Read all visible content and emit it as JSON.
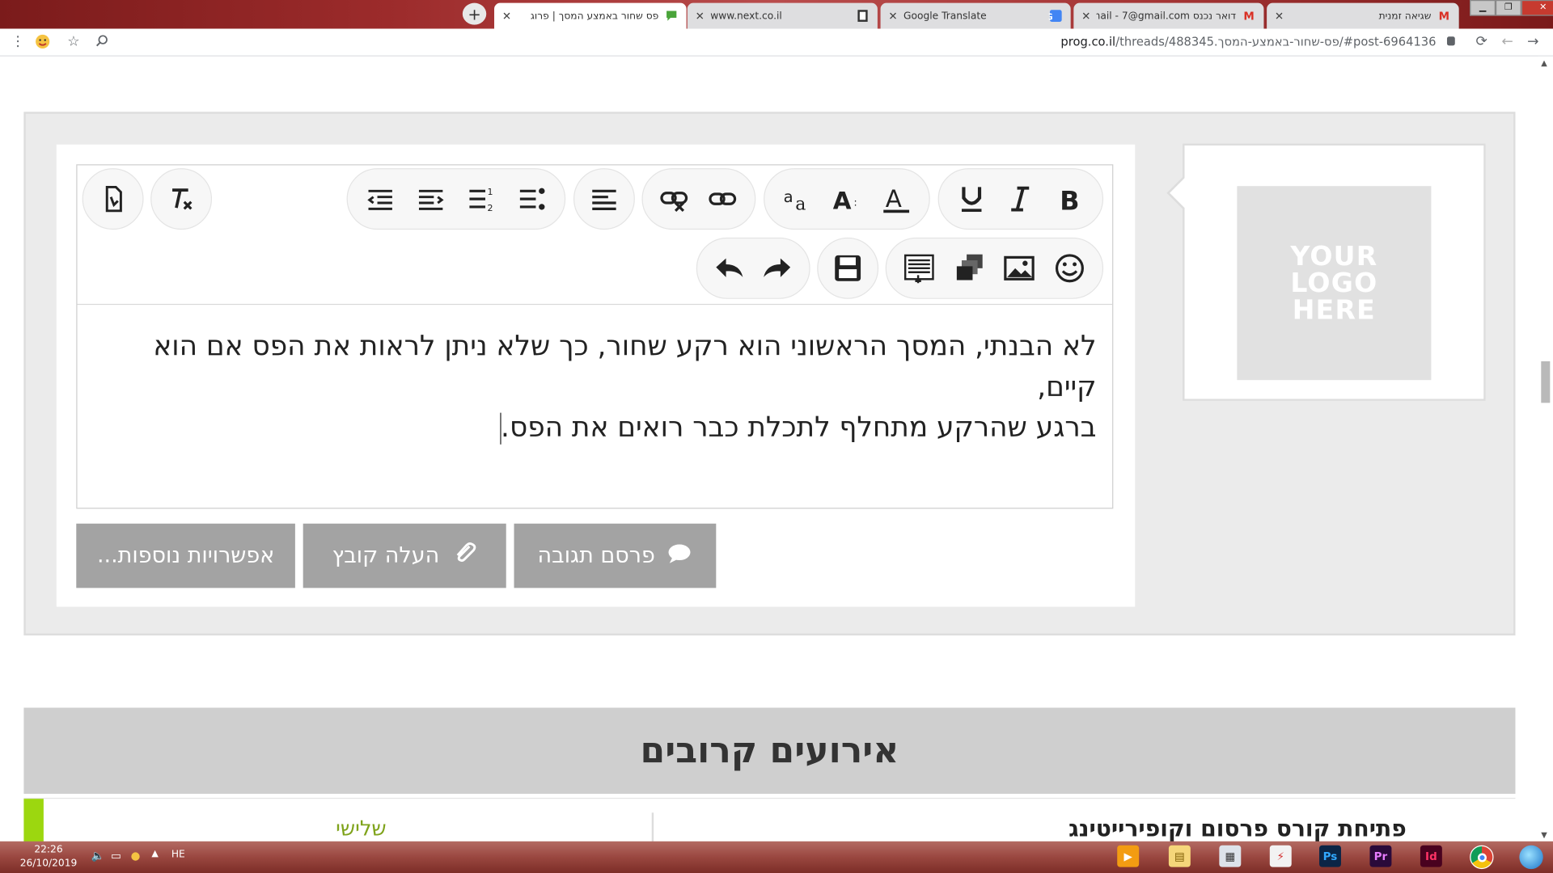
{
  "browser": {
    "tabs": [
      {
        "title": "פס שחור באמצע המסך | פרוג",
        "active": true,
        "favicon": "chat-bubble-icon"
      },
      {
        "title": "www.next.co.il",
        "active": false,
        "favicon": "page-icon"
      },
      {
        "title": "Google Translate",
        "active": false,
        "favicon": "translate-icon"
      },
      {
        "title": "דואר נכנס Gmail - 7@gmail.com",
        "active": false,
        "favicon": "gmail-icon"
      },
      {
        "title": "שגיאה זמנית",
        "active": false,
        "favicon": "gmail-icon"
      }
    ],
    "new_tab": "+",
    "url_domain": "prog.co.il",
    "url_path": "/threads/488345.פס-שחור-באמצע-המסך/#post-6964136"
  },
  "editor": {
    "toolbar": [
      {
        "name": "bold-icon",
        "label": "B"
      },
      {
        "name": "italic-icon",
        "label": "I"
      },
      {
        "name": "underline-icon",
        "label": "U"
      },
      {
        "name": "font-color-icon",
        "label": "A"
      },
      {
        "name": "font-size-icon",
        "label": "A:"
      },
      {
        "name": "font-family-icon",
        "label": "aa"
      },
      {
        "name": "link-icon"
      },
      {
        "name": "unlink-icon"
      },
      {
        "name": "align-icon"
      },
      {
        "name": "bullet-list-icon"
      },
      {
        "name": "numbered-list-icon"
      },
      {
        "name": "indent-icon"
      },
      {
        "name": "outdent-icon"
      },
      {
        "name": "remove-format-icon"
      },
      {
        "name": "bbcode-icon"
      },
      {
        "name": "smiley-icon"
      },
      {
        "name": "image-icon"
      },
      {
        "name": "media-icon"
      },
      {
        "name": "insert-icon"
      },
      {
        "name": "save-draft-icon"
      },
      {
        "name": "redo-icon"
      },
      {
        "name": "undo-icon"
      }
    ],
    "content_line1": "לא הבנתי, המסך הראשוני הוא רקע שחור, כך שלא ניתן לראות את הפס אם הוא קיים,",
    "content_line2": "ברגע שהרקע מתחלף לתכלת כבר רואים את הפס."
  },
  "actions": {
    "post_reply": "פרסם תגובה",
    "upload_file": "העלה קובץ",
    "more_options": "אפשרויות נוספות..."
  },
  "sidebar": {
    "logo_line1": "YOUR",
    "logo_line2": "LOGO",
    "logo_line3": "HERE"
  },
  "events": {
    "heading": "אירועים קרובים",
    "first_day": "שלישי",
    "first_title": "פתיחת קורס פרסום וקופירייטינג"
  },
  "taskbar": {
    "time": "22:26",
    "date": "26/10/2019",
    "lang": "HE"
  },
  "colors": {
    "tabstrip": "#9c2b2b",
    "button_gray": "#a3a3a3",
    "event_green": "#9cd70f",
    "events_bg": "#cfcfcf"
  }
}
